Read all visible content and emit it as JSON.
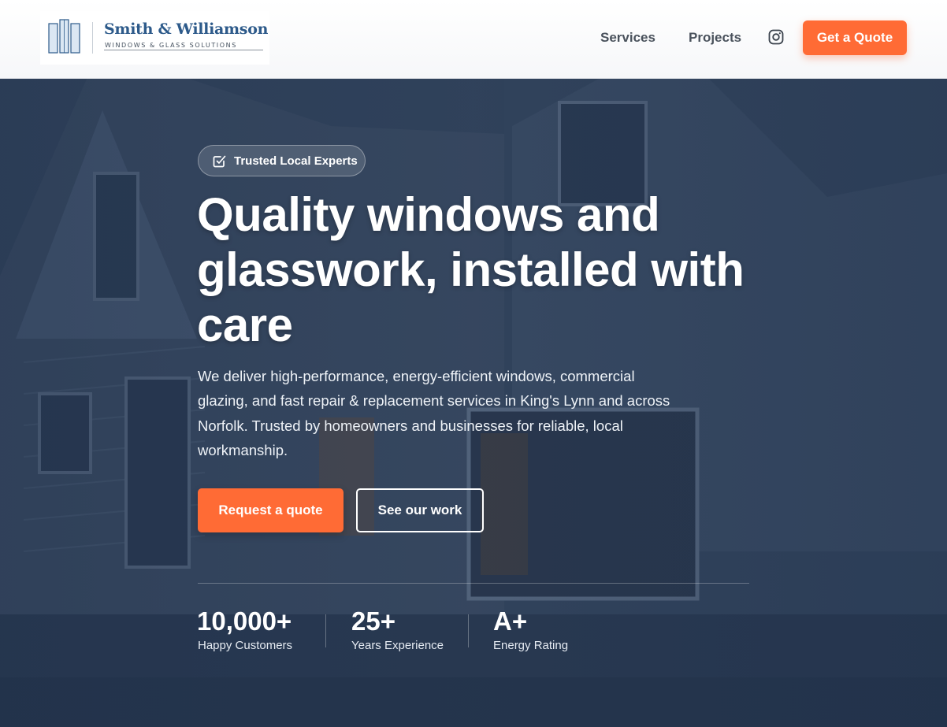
{
  "brand": {
    "name": "Smith & Williamson",
    "tagline": "WINDOWS & GLASS SOLUTIONS"
  },
  "nav": {
    "items": [
      {
        "label": "Services"
      },
      {
        "label": "Projects"
      }
    ],
    "social_icon": "instagram-icon",
    "cta_label": "Get a Quote"
  },
  "hero": {
    "badge": "Trusted Local Experts",
    "headline": "Quality windows and glasswork, installed with care",
    "description": "We deliver high-performance, energy-efficient windows, commercial glazing, and fast repair & replacement services in King's Lynn and across Norfolk. Trusted by homeowners and businesses for reliable, local workmanship.",
    "primary_button": "Request a quote",
    "secondary_button": "See our work"
  },
  "stats": [
    {
      "value": "10,000+",
      "label": "Happy Customers"
    },
    {
      "value": "25+",
      "label": "Years Experience"
    },
    {
      "value": "A+",
      "label": "Energy Rating"
    }
  ],
  "colors": {
    "accent": "#ff6b35",
    "brand_blue": "#2d5a8a",
    "hero_overlay": "#2e4160"
  }
}
